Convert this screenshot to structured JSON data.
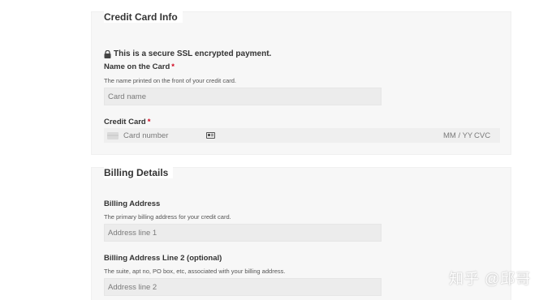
{
  "credit_card_section": {
    "title": "Credit Card Info",
    "secure_note": "This is a secure SSL encrypted payment.",
    "name_on_card": {
      "label": "Name on the Card",
      "required_mark": "*",
      "description": "The name printed on the front of your credit card.",
      "placeholder": "Card name",
      "value": ""
    },
    "credit_card": {
      "label": "Credit Card",
      "required_mark": "*",
      "number_placeholder": "Card number",
      "expiry_placeholder": "MM / YY",
      "cvc_placeholder": "CVC"
    }
  },
  "billing_section": {
    "title": "Billing Details",
    "address_line1": {
      "label": "Billing Address",
      "description": "The primary billing address for your credit card.",
      "placeholder": "Address line 1",
      "value": ""
    },
    "address_line2": {
      "label": "Billing Address Line 2 (optional)",
      "description": "The suite, apt no, PO box, etc, associated with your billing address.",
      "placeholder": "Address line 2",
      "value": ""
    }
  },
  "icons": {
    "lock": "lock-icon",
    "card_brand": "credit-card-icon",
    "autofill": "card-autofill-icon"
  },
  "watermark": "知乎 @邱哥"
}
